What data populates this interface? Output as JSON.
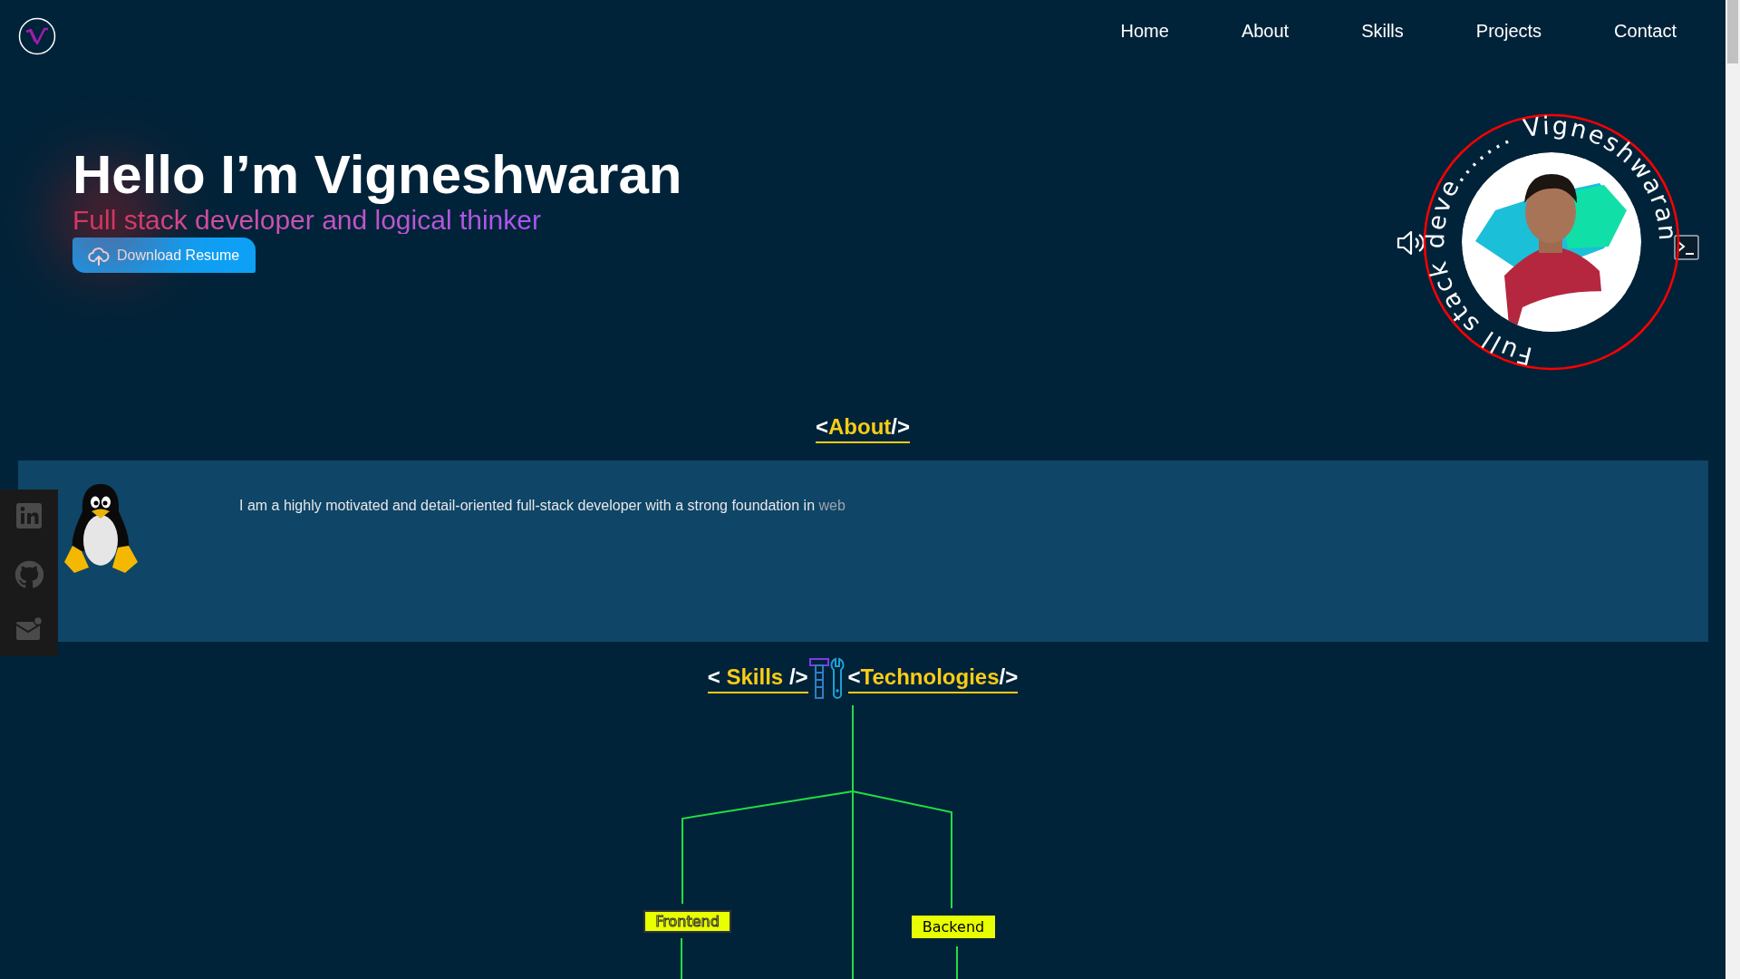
{
  "nav": {
    "items": [
      "Home",
      "About",
      "Skills",
      "Projects",
      "Contact"
    ]
  },
  "hero": {
    "greeting": "Hello I’m Vigneshwaran",
    "tagline": "Full stack developer and logical thinker",
    "button": "Download Resume"
  },
  "avatar": {
    "ring_texts": [
      "Full stack deve.......",
      "Vigneshwaran"
    ]
  },
  "about": {
    "heading": {
      "open": "<",
      "word": "About",
      "close": "/>"
    },
    "text": "I am a highly motivated and detail-oriented full-stack developer with a strong foundation in",
    "typing": "web"
  },
  "skills": {
    "heading": {
      "open": "<",
      "word": "Skills",
      "close": "/>",
      "open2": "<",
      "word2": "Technologies",
      "close2": "/>"
    },
    "nodes": [
      {
        "label": "Frontend",
        "kind": "outlined"
      },
      {
        "label": "Backend",
        "kind": "solid"
      }
    ]
  }
}
